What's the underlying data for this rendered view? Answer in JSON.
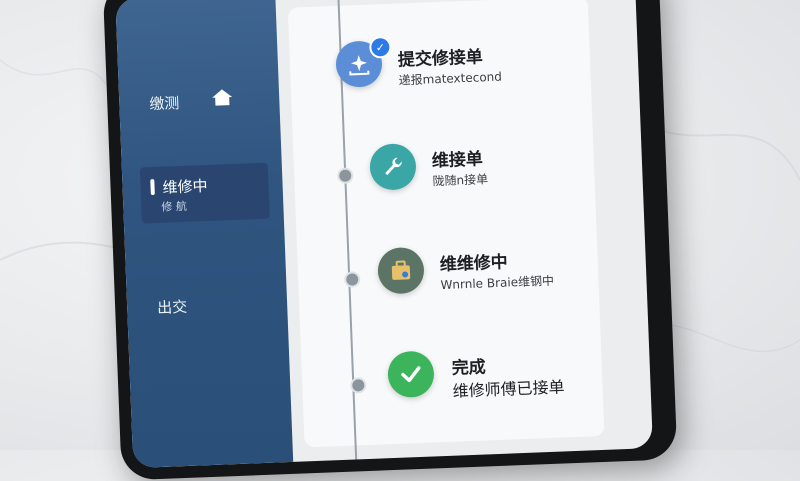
{
  "sidebar": {
    "items": [
      {
        "label": "缴测",
        "icon": "home-icon"
      },
      {
        "label": "维修中",
        "sublabel": "修 航"
      },
      {
        "label": "出交"
      }
    ]
  },
  "timeline": {
    "steps": [
      {
        "title": "提交修接单",
        "subtitle": "递报matextecond",
        "icon": "upload-icon",
        "color": "#5b8ed6",
        "checked": true
      },
      {
        "title": "维接单",
        "subtitle": "陇随n接单",
        "icon": "wrench-icon",
        "color": "#3aa6a6"
      },
      {
        "title": "维维修中",
        "subtitle": "Wnrnle Braie维钢中",
        "icon": "toolbox-icon",
        "color": "#5b7466"
      },
      {
        "title": "完成",
        "subtitle": "维修师傅已接单",
        "icon": "checkmark-icon",
        "color": "#3cb45c"
      }
    ]
  },
  "colors": {
    "sidebar": "#2f5580",
    "accent": "#2d7be6"
  }
}
